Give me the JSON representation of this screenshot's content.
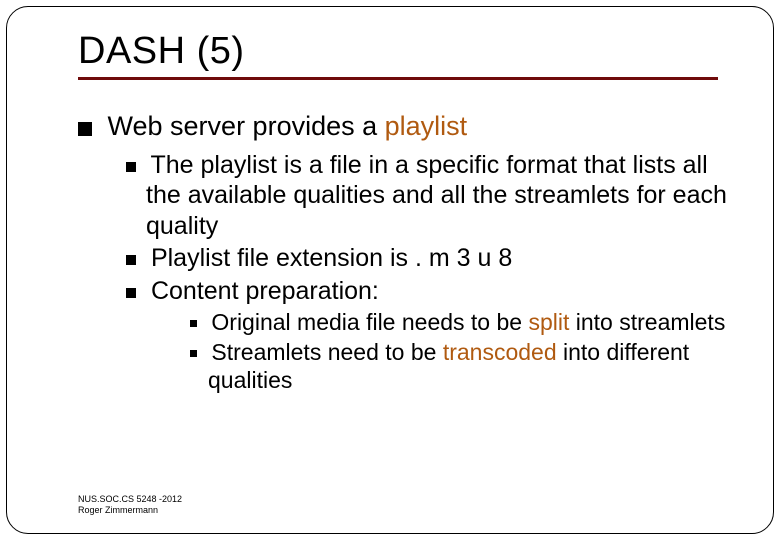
{
  "title": "DASH (5)",
  "bullets": {
    "l1": {
      "pre": "Web server provides a ",
      "hl": "playlist",
      "post": ""
    },
    "l2a": "The playlist is a file in a specific format that lists all the available qualities and all the streamlets for each quality",
    "l2b": "Playlist file extension is . m 3 u 8",
    "l2c": "Content preparation:",
    "l3a": {
      "pre": "Original media file needs to be ",
      "hl": "split",
      "post": " into streamlets"
    },
    "l3b": {
      "pre": "Streamlets need to be ",
      "hl": "transcoded",
      "post": " into different qualities"
    }
  },
  "footer": {
    "line1": "NUS.SOC.CS 5248 -2012",
    "line2": "Roger Zimmermann"
  }
}
